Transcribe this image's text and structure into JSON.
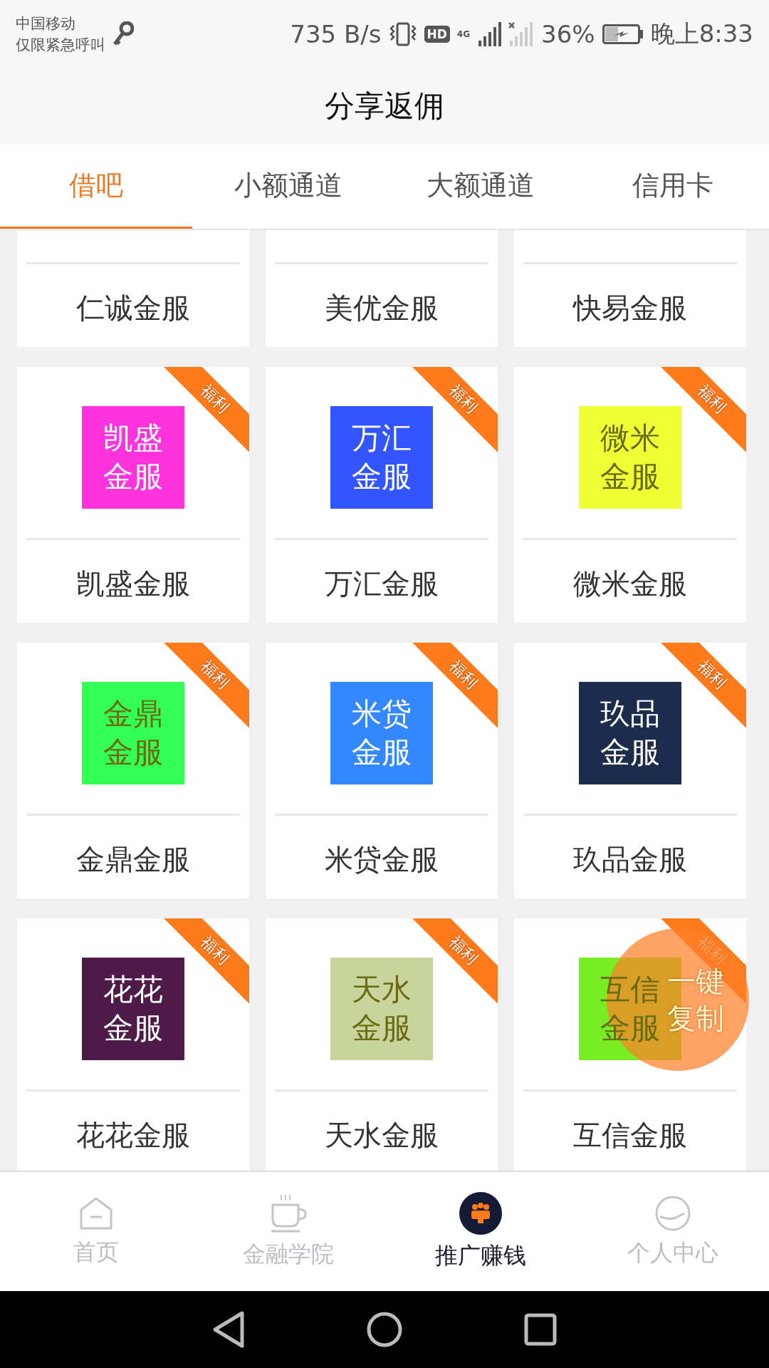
{
  "status_bar": {
    "carrier": "中国移动",
    "carrier_note": "仅限紧急呼叫",
    "speed": "735 B/s",
    "hd": "HD",
    "network": "4G",
    "battery": "36%",
    "time": "晚上8:33"
  },
  "header": {
    "title": "分享返佣"
  },
  "tabs": [
    {
      "label": "借吧",
      "selected": true
    },
    {
      "label": "小额通道",
      "selected": false
    },
    {
      "label": "大额通道",
      "selected": false
    },
    {
      "label": "信用卡",
      "selected": false
    }
  ],
  "cards": [
    {
      "name": "仁诚金服"
    },
    {
      "name": "美优金服"
    },
    {
      "name": "快易金服"
    },
    {
      "name": "凯盛金服",
      "badge": "福利",
      "logo": [
        "凯盛",
        "金服"
      ],
      "color": "#ff33dd"
    },
    {
      "name": "万汇金服",
      "badge": "福利",
      "logo": [
        "万汇",
        "金服"
      ],
      "color": "#3355ff"
    },
    {
      "name": "微米金服",
      "badge": "福利",
      "logo": [
        "微米",
        "金服"
      ],
      "color": "#eeff33"
    },
    {
      "name": "金鼎金服",
      "badge": "福利",
      "logo": [
        "金鼎",
        "金服"
      ],
      "color": "#33ff55"
    },
    {
      "name": "米贷金服",
      "badge": "福利",
      "logo": [
        "米贷",
        "金服"
      ],
      "color": "#3388ff"
    },
    {
      "name": "玖品金服",
      "badge": "福利",
      "logo": [
        "玖品",
        "金服"
      ],
      "color": "#1c2c4c"
    },
    {
      "name": "花花金服",
      "badge": "福利",
      "logo": [
        "花花",
        "金服"
      ],
      "color": "#4e1a48"
    },
    {
      "name": "天水金服",
      "badge": "福利",
      "logo": [
        "天水",
        "金服"
      ],
      "color": "#c8d49c"
    },
    {
      "name": "互信金服",
      "badge": "福利",
      "logo": [
        "互信",
        "金服"
      ],
      "color": "#77ee22"
    }
  ],
  "floating_button": {
    "lines": [
      "一键",
      "复制"
    ]
  },
  "bottom_nav": [
    {
      "label": "首页",
      "kind": "home",
      "selected": false
    },
    {
      "label": "金融学院",
      "kind": "cup",
      "selected": false
    },
    {
      "label": "推广赚钱",
      "kind": "people",
      "selected": true
    },
    {
      "label": "个人中心",
      "kind": "face",
      "selected": false
    }
  ]
}
